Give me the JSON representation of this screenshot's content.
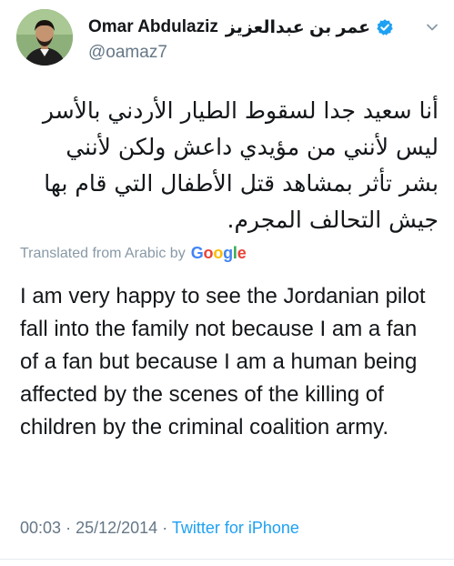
{
  "author": {
    "name": "Omar Abdulaziz",
    "name_arabic": "عمر بن عبدالعزيز",
    "handle": "@oamaz7",
    "verified": true
  },
  "tweet": {
    "text_arabic": "أنا سعيد جدا لسقوط الطيار الأردني بالأسر ليس لأنني من مؤيدي داعش ولكن لأنني بشر تأثر بمشاهد قتل الأطفال التي قام بها جيش التحالف المجرم.",
    "translated_label": "Translated from Arabic by",
    "google_letters": [
      "G",
      "o",
      "o",
      "g",
      "l",
      "e"
    ],
    "text_english": "I am very happy to see the Jordanian pilot fall into the family not because I am a fan of a fan but because I am a human being affected by the scenes of the killing of children by the criminal coalition army.",
    "time": "00:03",
    "date": "25/12/2014",
    "separator": "·",
    "source": "Twitter for iPhone"
  },
  "colors": {
    "verified_blue": "#1da1f2",
    "secondary_text": "#657786",
    "link_blue": "#1da1f2"
  },
  "icons": {
    "verified": "verified-badge-icon",
    "menu": "chevron-down-icon"
  }
}
